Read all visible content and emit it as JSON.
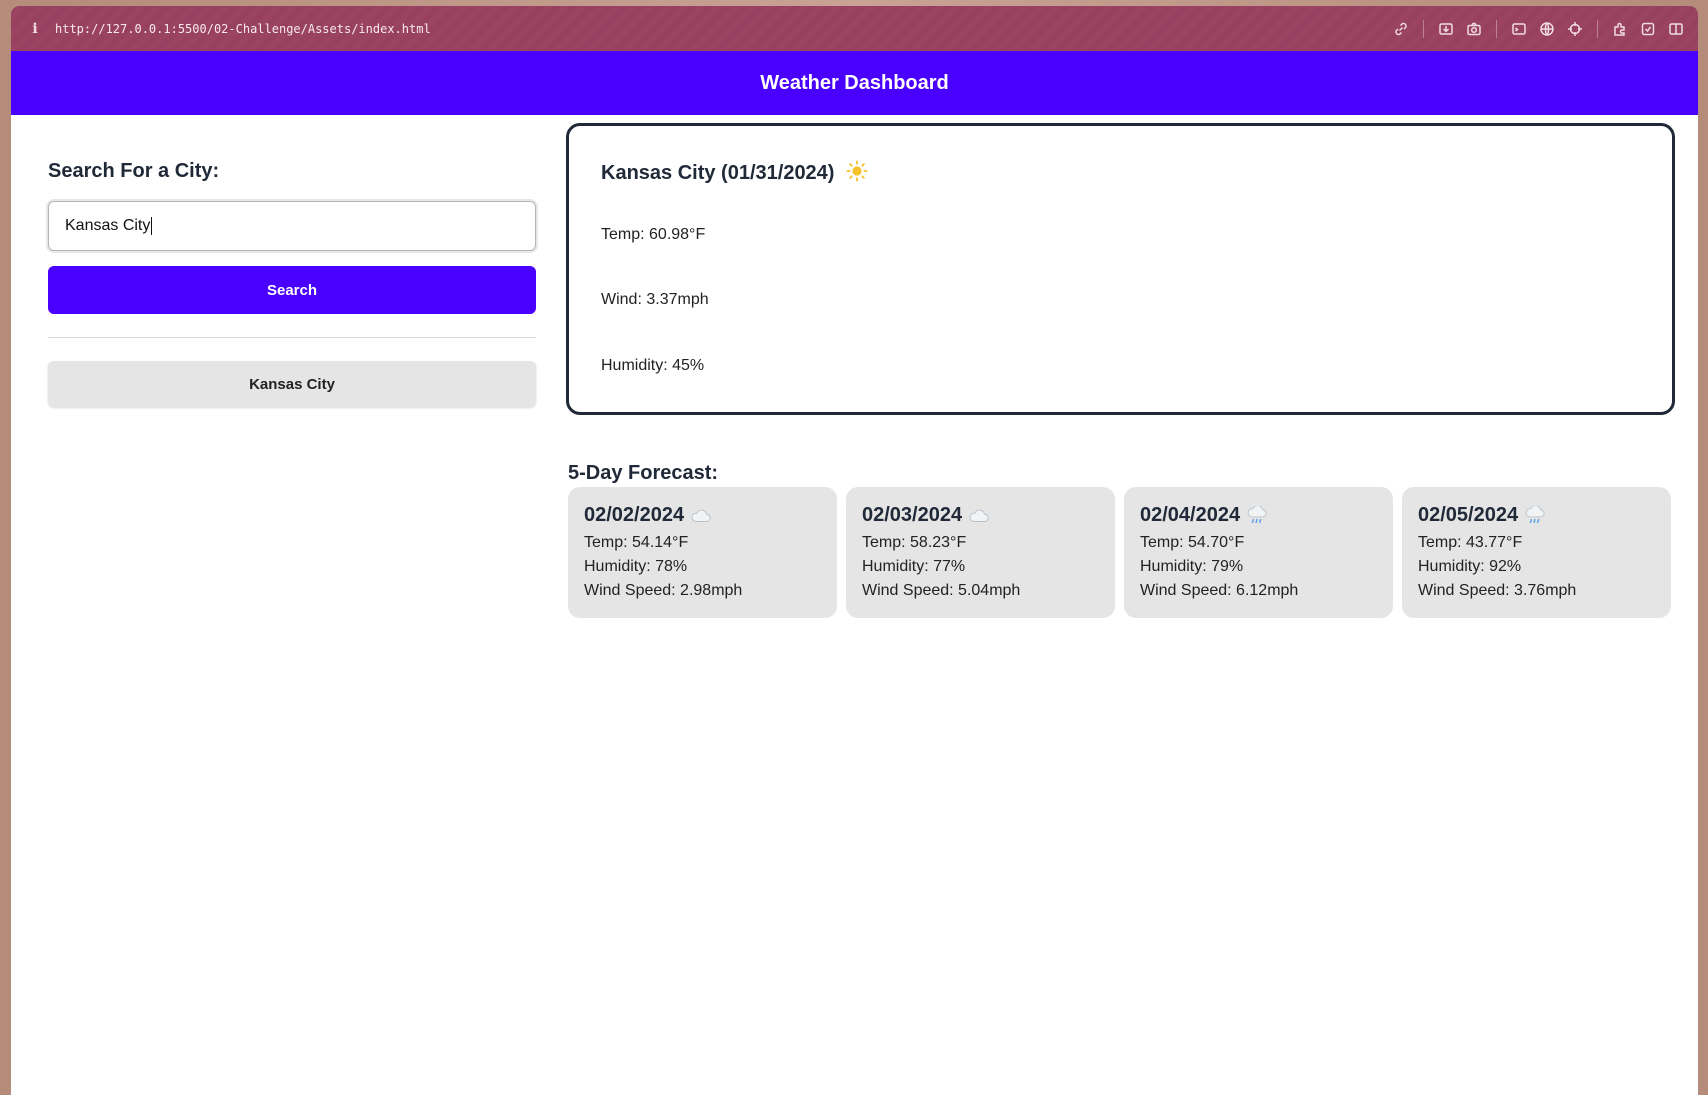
{
  "browser": {
    "url": "http://127.0.0.1:5500/02-Challenge/Assets/index.html"
  },
  "header": {
    "title": "Weather Dashboard"
  },
  "sidebar": {
    "heading": "Search For a City:",
    "input_value": "Kansas City",
    "search_label": "Search",
    "history": [
      "Kansas City"
    ]
  },
  "current": {
    "title": "Kansas City (01/31/2024)",
    "icon": "sun-icon",
    "temp": "Temp: 60.98°F",
    "wind": "Wind: 3.37mph",
    "humidity": "Humidity: 45%"
  },
  "forecast": {
    "heading": "5-Day Forecast:",
    "days": [
      {
        "date": "02/02/2024",
        "icon": "cloud-icon",
        "temp": "Temp: 54.14°F",
        "humidity": "Humidity: 78%",
        "wind": "Wind Speed: 2.98mph"
      },
      {
        "date": "02/03/2024",
        "icon": "cloud-icon",
        "temp": "Temp: 58.23°F",
        "humidity": "Humidity: 77%",
        "wind": "Wind Speed: 5.04mph"
      },
      {
        "date": "02/04/2024",
        "icon": "rain-cloud-icon",
        "temp": "Temp: 54.70°F",
        "humidity": "Humidity: 79%",
        "wind": "Wind Speed: 6.12mph"
      },
      {
        "date": "02/05/2024",
        "icon": "rain-cloud-icon",
        "temp": "Temp: 43.77°F",
        "humidity": "Humidity: 92%",
        "wind": "Wind Speed: 3.76mph"
      }
    ]
  },
  "colors": {
    "accent": "#4a00ff",
    "card_bg": "#e5e5e5",
    "chrome": "#97405f"
  }
}
